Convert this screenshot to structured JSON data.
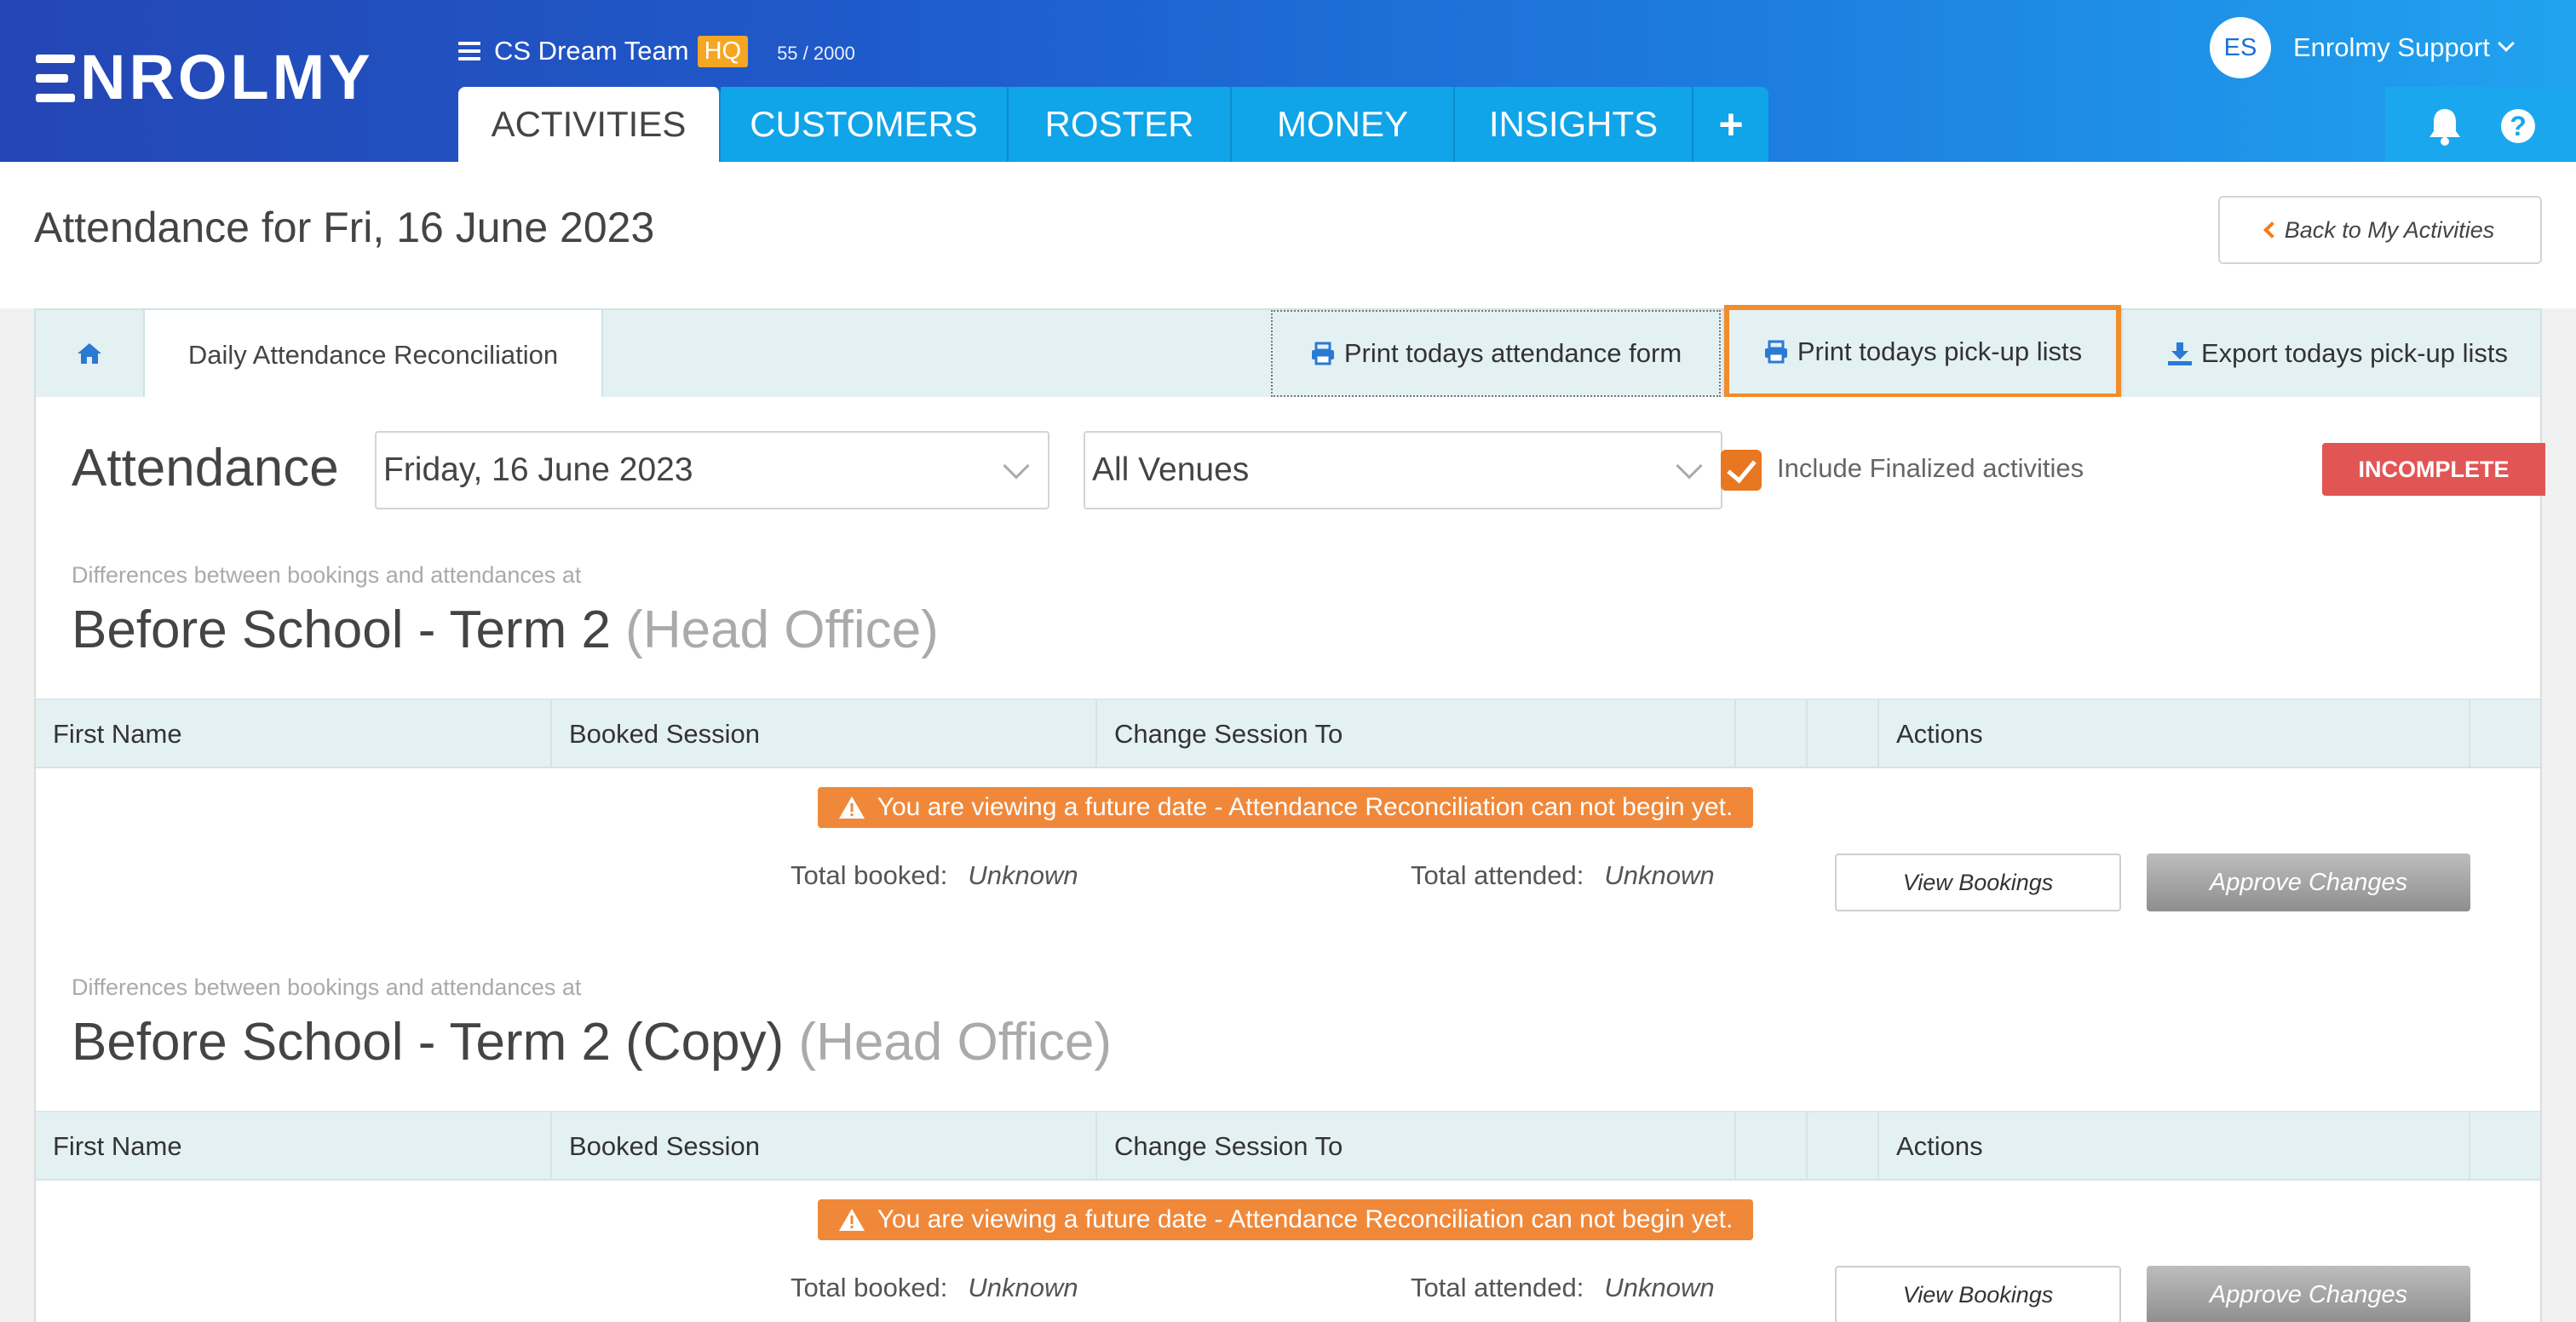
{
  "brand": {
    "logo_text": "NROLMY",
    "logo_full": "ENROLMY"
  },
  "team": {
    "name": "CS Dream Team",
    "badge": "HQ",
    "count": "55 / 2000"
  },
  "nav": {
    "tabs": [
      {
        "label": "ACTIVITIES",
        "active": true
      },
      {
        "label": "CUSTOMERS"
      },
      {
        "label": "ROSTER"
      },
      {
        "label": "MONEY"
      },
      {
        "label": "INSIGHTS"
      },
      {
        "label": "+"
      }
    ]
  },
  "user": {
    "initials": "ES",
    "name": "Enrolmy Support"
  },
  "icons": {
    "bell": "bell-icon",
    "help": "question-circle-icon",
    "help_glyph": "?"
  },
  "page": {
    "title": "Attendance for Fri, 16 June 2023",
    "back_label": "Back to My Activities"
  },
  "tabbar": {
    "recon_tab": "Daily Attendance Reconciliation",
    "print_form": "Print todays attendance form",
    "print_pickup": "Print todays pick-up lists",
    "export_pickup": "Export todays pick-up lists"
  },
  "filters": {
    "label": "Attendance",
    "date_value": "Friday, 16 June 2023",
    "venue_value": "All Venues",
    "include_finalized_label": "Include Finalized activities",
    "include_finalized": true,
    "status_badge": "INCOMPLETE"
  },
  "columns": [
    "First Name",
    "Booked Session",
    "Change Session To",
    "",
    "",
    "Actions"
  ],
  "sections": [
    {
      "caption": "Differences between bookings and attendances at",
      "title": "Before School - Term 2",
      "location": "(Head Office)",
      "warning": "You are viewing a future date - Attendance Reconciliation can not begin yet.",
      "total_booked_label": "Total booked:",
      "total_booked": "Unknown",
      "total_attended_label": "Total attended:",
      "total_attended": "Unknown",
      "view_label": "View Bookings",
      "approve_label": "Approve Changes"
    },
    {
      "caption": "Differences between bookings and attendances at",
      "title": "Before School - Term 2 (Copy)",
      "location": "(Head Office)",
      "warning": "You are viewing a future date - Attendance Reconciliation can not begin yet.",
      "total_booked_label": "Total booked:",
      "total_booked": "Unknown",
      "total_attended_label": "Total attended:",
      "total_attended": "Unknown",
      "view_label": "View Bookings",
      "approve_label": "Approve Changes"
    }
  ],
  "colors": {
    "accent_orange": "#e87722",
    "nav_blue": "#10a4e8",
    "badge_red": "#e25555",
    "warn_orange": "#f0883a"
  }
}
